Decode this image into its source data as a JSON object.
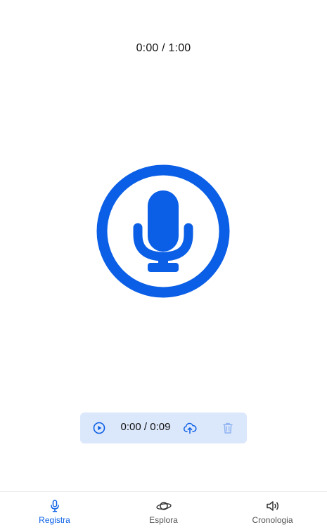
{
  "recorder": {
    "elapsed": "0:00 / 1:00"
  },
  "playback": {
    "time": "0:00 / 0:09"
  },
  "nav": {
    "items": [
      {
        "label": "Registra",
        "icon": "microphone-icon",
        "active": true
      },
      {
        "label": "Esplora",
        "icon": "planet-icon",
        "active": false
      },
      {
        "label": "Cronologia",
        "icon": "speaker-icon",
        "active": false
      }
    ]
  },
  "colors": {
    "accent": "#0a5fe6",
    "playback_bg": "#dbe7fb",
    "delete_icon": "#8fb4f2",
    "nav_inactive": "#555555"
  }
}
